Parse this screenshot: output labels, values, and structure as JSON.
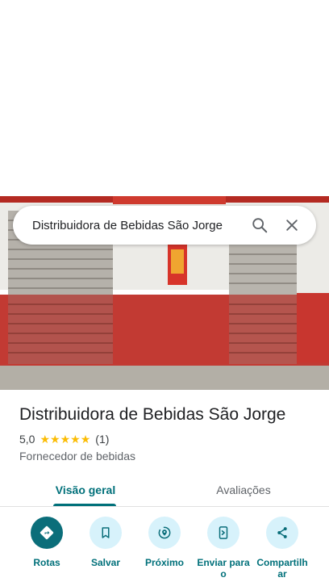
{
  "search": {
    "query": "Distribuidora de Bebidas São Jorge"
  },
  "place": {
    "title": "Distribuidora de Bebidas São Jorge",
    "rating_value": "5,0",
    "stars": 5,
    "review_count": "(1)",
    "category": "Fornecedor de bebidas"
  },
  "tabs": [
    {
      "label": "Visão geral",
      "selected": true
    },
    {
      "label": "Avaliações",
      "selected": false
    }
  ],
  "actions": [
    {
      "label": "Rotas",
      "icon": "directions-icon"
    },
    {
      "label": "Salvar",
      "icon": "bookmark-icon"
    },
    {
      "label": "Próximo",
      "icon": "nearby-icon"
    },
    {
      "label": "Enviar para o",
      "icon": "send-to-phone-icon"
    },
    {
      "label": "Compartilhar",
      "icon": "share-icon"
    }
  ],
  "colors": {
    "accent": "#00707a",
    "action_bg": "#d7f2fb",
    "star": "#fbbc04"
  }
}
